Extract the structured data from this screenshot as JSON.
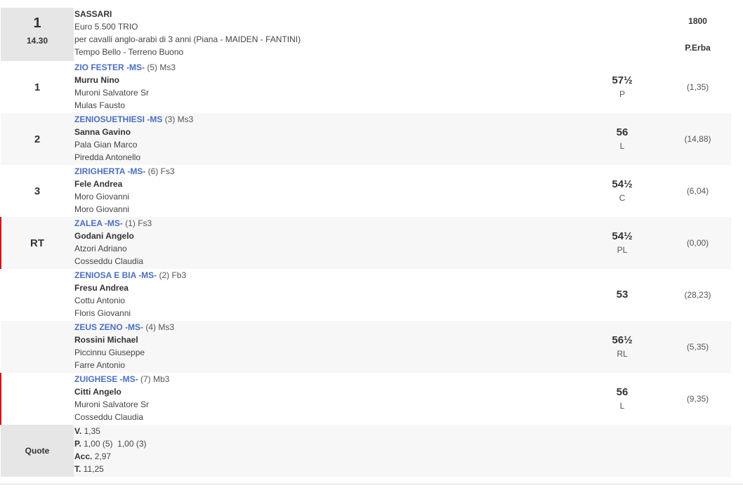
{
  "race": {
    "number": "1",
    "time": "14.30",
    "venue": "SASSARI",
    "prize": "Euro 5.500 TRIO",
    "conditions": "per cavalli anglo-arabi di 3 anni (Piana -  MAIDEN  - FANTINI)",
    "weather": "Tempo Bello - Terreno Buono",
    "distance": "1800",
    "judge": "P.Erba"
  },
  "runners": [
    {
      "pos": "1",
      "horse": "ZIO FESTER -MS-",
      "suffix": " (5) Ms3",
      "jockey": "Murru Nino",
      "trainer": "Muroni Salvatore Sr",
      "owner": "Mulas Fausto",
      "weight": "57½",
      "code": "P",
      "odds": "(1,35)",
      "rt": false
    },
    {
      "pos": "2",
      "horse": "ZENIOSUETHIESI -MS",
      "suffix": " (3) Ms3",
      "jockey": "Sanna Gavino",
      "trainer": "Pala Gian Marco",
      "owner": "Piredda Antonello",
      "weight": "56",
      "code": "L",
      "odds": "(14,88)",
      "rt": false
    },
    {
      "pos": "3",
      "horse": "ZIRIGHERTA -MS-",
      "suffix": " (6) Fs3",
      "jockey": "Fele Andrea",
      "trainer": "Moro Giovanni",
      "owner": "Moro Giovanni",
      "weight": "54½",
      "code": "C",
      "odds": "(6,04)",
      "rt": false
    },
    {
      "pos": "RT",
      "horse": "ZALEA -MS-",
      "suffix": " (1) Fs3",
      "jockey": "Godani Angelo",
      "trainer": "Atzori Adriano",
      "owner": "Cosseddu Claudia",
      "weight": "54½",
      "code": "PL",
      "odds": "(0,00)",
      "rt": true
    },
    {
      "pos": "",
      "horse": "ZENIOSA E BIA -MS-",
      "suffix": " (2) Fb3",
      "jockey": "Fresu Andrea",
      "trainer": "Cottu Antonio",
      "owner": "Floris Giovanni",
      "weight": "53",
      "code": "",
      "odds": "(28,23)",
      "rt": false
    },
    {
      "pos": "",
      "horse": "ZEUS ZENO -MS-",
      "suffix": " (4) Ms3",
      "jockey": "Rossini Michael",
      "trainer": "Piccinnu Giuseppe",
      "owner": "Farre Antonio",
      "weight": "56½",
      "code": "RL",
      "odds": "(5,35)",
      "rt": false
    },
    {
      "pos": "",
      "horse": "ZUIGHESE -MS-",
      "suffix": " (7) Mb3",
      "jockey": "Citti Angelo",
      "trainer": "Muroni Salvatore Sr",
      "owner": "Cosseddu Claudia",
      "weight": "56",
      "code": "L",
      "odds": "(9,35)",
      "rt": true
    }
  ],
  "quote": {
    "label": "Quote",
    "v_label": "V.",
    "v_value": " 1,35",
    "p_label": "P.",
    "p_value": " 1,00 (5)  1,00 (3)",
    "acc_label": "Acc.",
    "acc_value": " 2,97",
    "t_label": "T.",
    "t_value": " 11,25"
  }
}
